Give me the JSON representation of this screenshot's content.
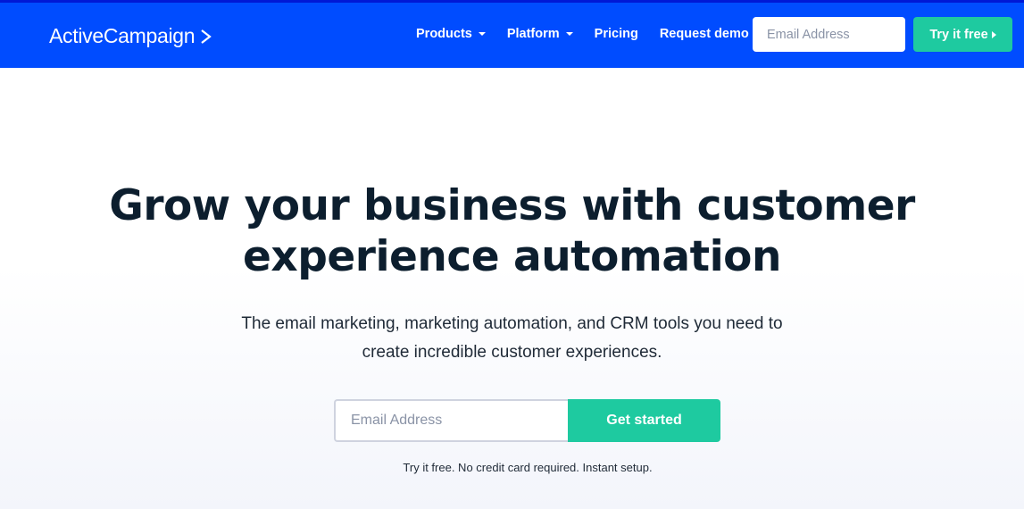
{
  "header": {
    "logo_text": "ActiveCampaign",
    "nav": [
      {
        "label": "Products",
        "has_dropdown": true
      },
      {
        "label": "Platform",
        "has_dropdown": true
      },
      {
        "label": "Pricing",
        "has_dropdown": false
      },
      {
        "label": "Request demo",
        "has_dropdown": false
      }
    ],
    "email_placeholder": "Email Address",
    "try_button_label": "Try it free"
  },
  "hero": {
    "headline_line1": "Grow your business with customer",
    "headline_line2": "experience automation",
    "subtext_line1": "The email marketing, marketing automation, and CRM tools you need to",
    "subtext_line2": "create incredible customer experiences.",
    "email_placeholder": "Email Address",
    "cta_label": "Get started",
    "note": "Try it free. No credit card required. Instant setup."
  },
  "colors": {
    "brand_blue": "#004cff",
    "accent_green": "#1ecaa0",
    "heading": "#0c1e2e"
  }
}
